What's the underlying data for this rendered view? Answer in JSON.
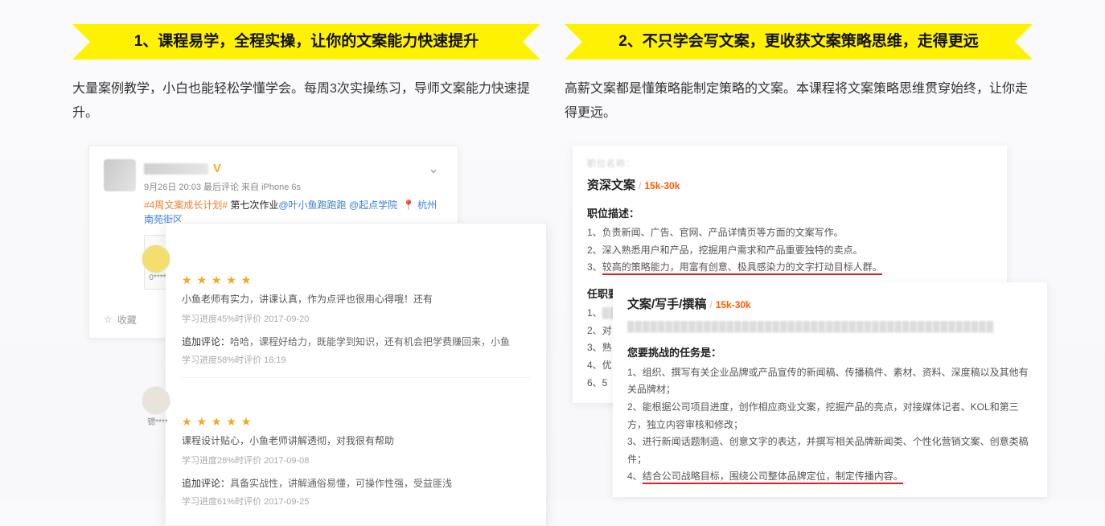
{
  "left": {
    "banner": "1、课程易学，全程实操，让你的文案能力快速提升",
    "desc": "大量案例教学，小白也能轻松学懂学会。每周3次实操练习，导师文案能力快速提升。",
    "weibo": {
      "v": "V",
      "chevron": "⌄",
      "meta": "9月26日 20:03 最后评论 来自 iPhone 6s",
      "hashtag": "#4周文案成长计划#",
      "assign": " 第七次作业",
      "at1": "@叶小鱼跑跑跑",
      "at2": "@起点学院",
      "loc_icon": "📍",
      "loc": "杭州 南苑街区",
      "fav_icon": "☆",
      "fav": "收藏"
    },
    "reviews": [
      {
        "name": "0****",
        "stars": "★ ★ ★ ★ ★",
        "text": "小鱼老师有实力，讲课认真，作为点评也很用心得哦！还有",
        "meta": "学习进度45%时评价   2017-09-20",
        "add_label": "追加评论：",
        "add": "哈哈，课程好给力，既能学到知识，还有机会把学费赚回来，小鱼",
        "meta2": "学习进度58%时评价   16:19"
      },
      {
        "name": "锶****",
        "stars": "★ ★ ★ ★ ★",
        "text": "课程设计贴心，小鱼老师讲解透彻，对我很有帮助",
        "meta": "学习进度28%时评价   2017-09-08",
        "add_label": "追加评论：",
        "add": "具备实战性，讲解通俗易懂，可操作性强，受益匪浅",
        "meta2": "学习进度61%时评价   2017-09-25"
      }
    ]
  },
  "right": {
    "banner": "2、不只学会写文案，更收获文案策略思维，走得更远",
    "desc": "高薪文案都是懂策略能制定策略的文案。本课程将文案策略思维贯穿始终，让你走得更远。",
    "jobA": {
      "title": "资深文案",
      "salary": "15k-30k",
      "sec1": "职位描述：",
      "li1": "1、负责新闻、广告、官网、产品详情页等方面的文案写作。",
      "li2": "2、深入熟悉用户和产品，挖掘用户需求和产品重要独特的卖点。",
      "li3a": "3、",
      "li3b": "较高的策略能力，用富有创意、极具感染力的文字打动目标人群。",
      "sec2": "任职要求：",
      "b1": "1、",
      "b2": "2、对",
      "b3": "3、熟",
      "b4": "4、优",
      "b5": "6、5"
    },
    "jobB": {
      "title": "文案/写手/撰稿",
      "salary": "15k-30k",
      "sec1": "您要挑战的任务是：",
      "li1": "1、组织、撰写有关企业品牌或产品宣传的新闻稿、传播稿件、素材、资料、深度稿以及其他有关品牌材；",
      "li2": "2、能根据公司项目进度，创作相应商业文案，挖掘产品的亮点，对接媒体记者、KOL和第三方，独立内容审核和修改；",
      "li3": "3、进行新闻话题制造、创意文字的表达，并撰写相关品牌新闻类、个性化营销文案、创意类稿件；",
      "li4a": "4、",
      "li4b": "结合公司战略目标，围绕公司整体品牌定位，制定传播内容。"
    }
  }
}
